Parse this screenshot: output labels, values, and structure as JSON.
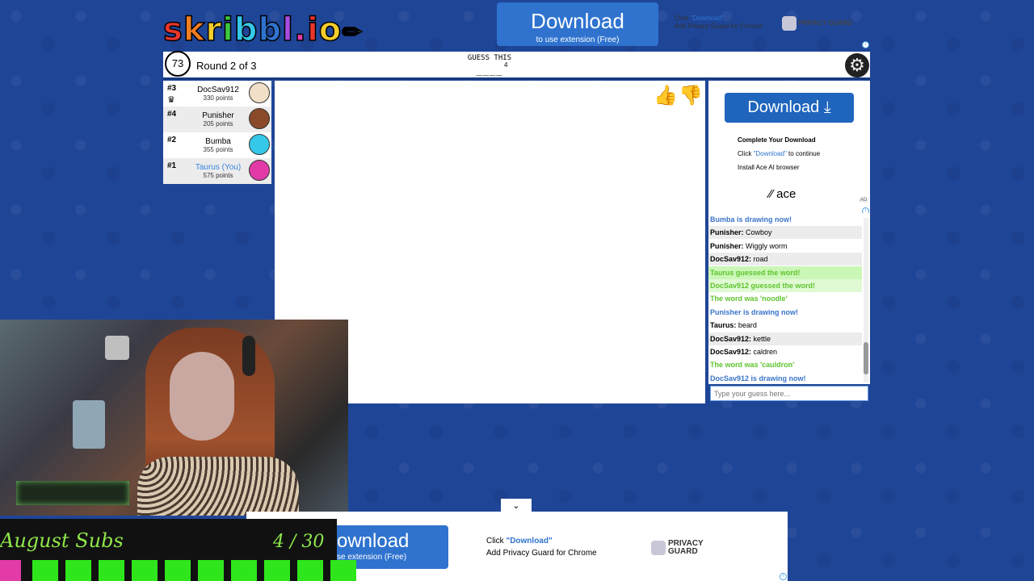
{
  "logo": {
    "letters": [
      "s",
      "k",
      "r",
      "i",
      "b",
      "b",
      "l",
      ".",
      "i",
      "o"
    ],
    "colors": [
      "#e8352c",
      "#f17d22",
      "#f5cd2b",
      "#3dc93f",
      "#35c8e8",
      "#2f73cf",
      "#a84de0",
      "#e23ba8",
      "#e8352c",
      "#f5cd2b"
    ],
    "pencil": "✏"
  },
  "top_ad": {
    "button_label": "Download",
    "button_sub": "to use extension (Free)",
    "hint_prefix": "Click ",
    "hint_link": "\"Download\"",
    "hint_line2": "Add Privacy Guard for Chrome",
    "brand": "PRIVACY GUARD"
  },
  "header": {
    "timer": "73",
    "round_text": "Round 2 of 3",
    "guess_label": "GUESS THIS",
    "guess_word": "____",
    "guess_count": "4",
    "settings_icon": "⚙"
  },
  "players": [
    {
      "rank": "#3",
      "name": "DocSav912",
      "points": "330 points",
      "avatar_color": "#f2dfc8",
      "is_you": false,
      "crown": "♛"
    },
    {
      "rank": "#4",
      "name": "Punisher",
      "points": "205 points",
      "avatar_color": "#8a4a2a",
      "is_you": false
    },
    {
      "rank": "#2",
      "name": "Bumba",
      "points": "355 points",
      "avatar_color": "#35c8e8",
      "is_you": false
    },
    {
      "rank": "#1",
      "name": "Taurus (You)",
      "points": "575 points",
      "avatar_color": "#e23ba8",
      "is_you": true
    }
  ],
  "votes": {
    "like_icon": "👍",
    "dislike_icon": "👎"
  },
  "side_ad": {
    "button_label": "Download ⤓",
    "complete_text": "Complete Your Download",
    "step1_prefix": "Click ",
    "step1_link": "\"Download\"",
    "step1_suffix": " to continue",
    "step2": "Install Ace AI browser",
    "brand": "⁄⁄ ace",
    "ad_tag": "AD"
  },
  "chat": {
    "messages": [
      {
        "speaker": "",
        "text": "Bumba is drawing now!",
        "style": "blue"
      },
      {
        "speaker": "Punisher:",
        "text": " Cowboy",
        "style": ""
      },
      {
        "speaker": "Punisher:",
        "text": " Wiggly worm",
        "style": ""
      },
      {
        "speaker": "DocSav912:",
        "text": " road",
        "style": ""
      },
      {
        "speaker": "",
        "text": "Taurus guessed the word!",
        "style": "green-bg"
      },
      {
        "speaker": "",
        "text": "DocSav912 guessed the word!",
        "style": "green-bg2"
      },
      {
        "speaker": "",
        "text": "The word was 'noodle'",
        "style": "green"
      },
      {
        "speaker": "",
        "text": "Punisher is drawing now!",
        "style": "blue"
      },
      {
        "speaker": "Taurus:",
        "text": " beard",
        "style": ""
      },
      {
        "speaker": "DocSav912:",
        "text": " kettle",
        "style": ""
      },
      {
        "speaker": "DocSav912:",
        "text": " caldren",
        "style": ""
      },
      {
        "speaker": "",
        "text": "The word was 'cauldron'",
        "style": "green"
      },
      {
        "speaker": "",
        "text": "DocSav912 is drawing now!",
        "style": "blue"
      }
    ],
    "input_placeholder": "Type your guess here..."
  },
  "subs": {
    "title": "August Subs",
    "count": "4 / 30",
    "filled_color": "#2fe61c"
  },
  "bottom_ad": {
    "button_label": "ownload",
    "button_sub": "se extension (Free)",
    "step1_prefix": "Click ",
    "step1_link": "\"Download\"",
    "step2": "Add Privacy Guard for Chrome",
    "brand_line1": "PRIVACY",
    "brand_line2": "GUARD",
    "chevron": "⌄"
  }
}
